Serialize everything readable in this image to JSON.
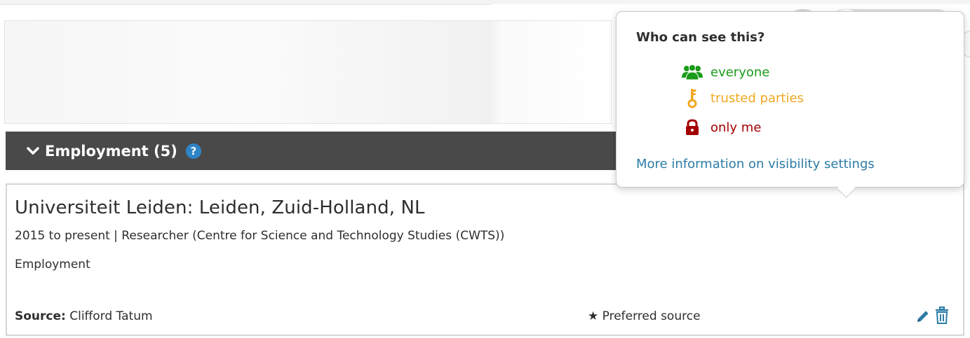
{
  "section": {
    "title": "Employment (5)",
    "help_icon": "?"
  },
  "employment": {
    "organization": "Universiteit Leiden: Leiden, Zuid-Holland, NL",
    "details": "2015 to present | Researcher (Centre for Science and Technology Studies (CWTS))",
    "type": "Employment",
    "source_label": "Source:",
    "source_value": "Clifford Tatum",
    "preferred": "★ Preferred source"
  },
  "visibility_popover": {
    "title": "Who can see this?",
    "options": [
      {
        "label": "everyone",
        "icon": "group-icon",
        "color": "#1a9b1a"
      },
      {
        "label": "trusted parties",
        "icon": "key-icon",
        "color": "#f0a821"
      },
      {
        "label": "only me",
        "icon": "lock-icon",
        "color": "#a30000"
      }
    ],
    "link": "More information on visibility settings",
    "selected": "everyone"
  },
  "colors": {
    "section_bar": "#494949",
    "help_blue": "#2e85c6",
    "link": "#2c7ca5"
  }
}
